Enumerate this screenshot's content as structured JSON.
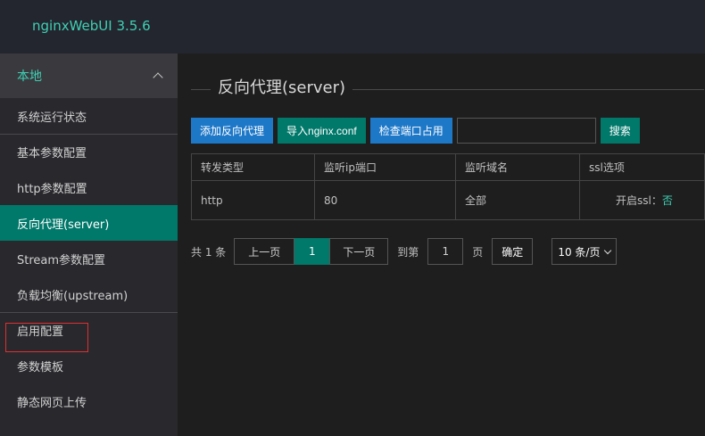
{
  "app": {
    "title": "nginxWebUI 3.5.6"
  },
  "sidebar": {
    "group": "本地",
    "items": [
      {
        "label": "系统运行状态"
      },
      {
        "label": "基本参数配置"
      },
      {
        "label": "http参数配置"
      },
      {
        "label": "反向代理(server)"
      },
      {
        "label": "Stream参数配置"
      },
      {
        "label": "负载均衡(upstream)"
      },
      {
        "label": "启用配置"
      },
      {
        "label": "参数模板"
      },
      {
        "label": "静态网页上传"
      }
    ]
  },
  "main": {
    "title": "反向代理(server)",
    "toolbar": {
      "add_label": "添加反向代理",
      "import_label": "导入nginx.conf",
      "check_label": "检查端口占用",
      "search_placeholder": "",
      "search_label": "搜索"
    },
    "table": {
      "headers": [
        "转发类型",
        "监听ip端口",
        "监听域名",
        "ssl选项"
      ],
      "rows": [
        {
          "type": "http",
          "port": "80",
          "domain": "全部",
          "ssl_label": "开启ssl：",
          "ssl_value": "否"
        }
      ]
    },
    "pagination": {
      "total": "共 1 条",
      "prev": "上一页",
      "current": "1",
      "next": "下一页",
      "goto": "到第",
      "goto_value": "1",
      "page_unit": "页",
      "confirm": "确定",
      "page_size": "10 条/页"
    }
  },
  "colors": {
    "accent": "#00786a",
    "primary": "#1e78c8",
    "highlight": "#e03030"
  }
}
